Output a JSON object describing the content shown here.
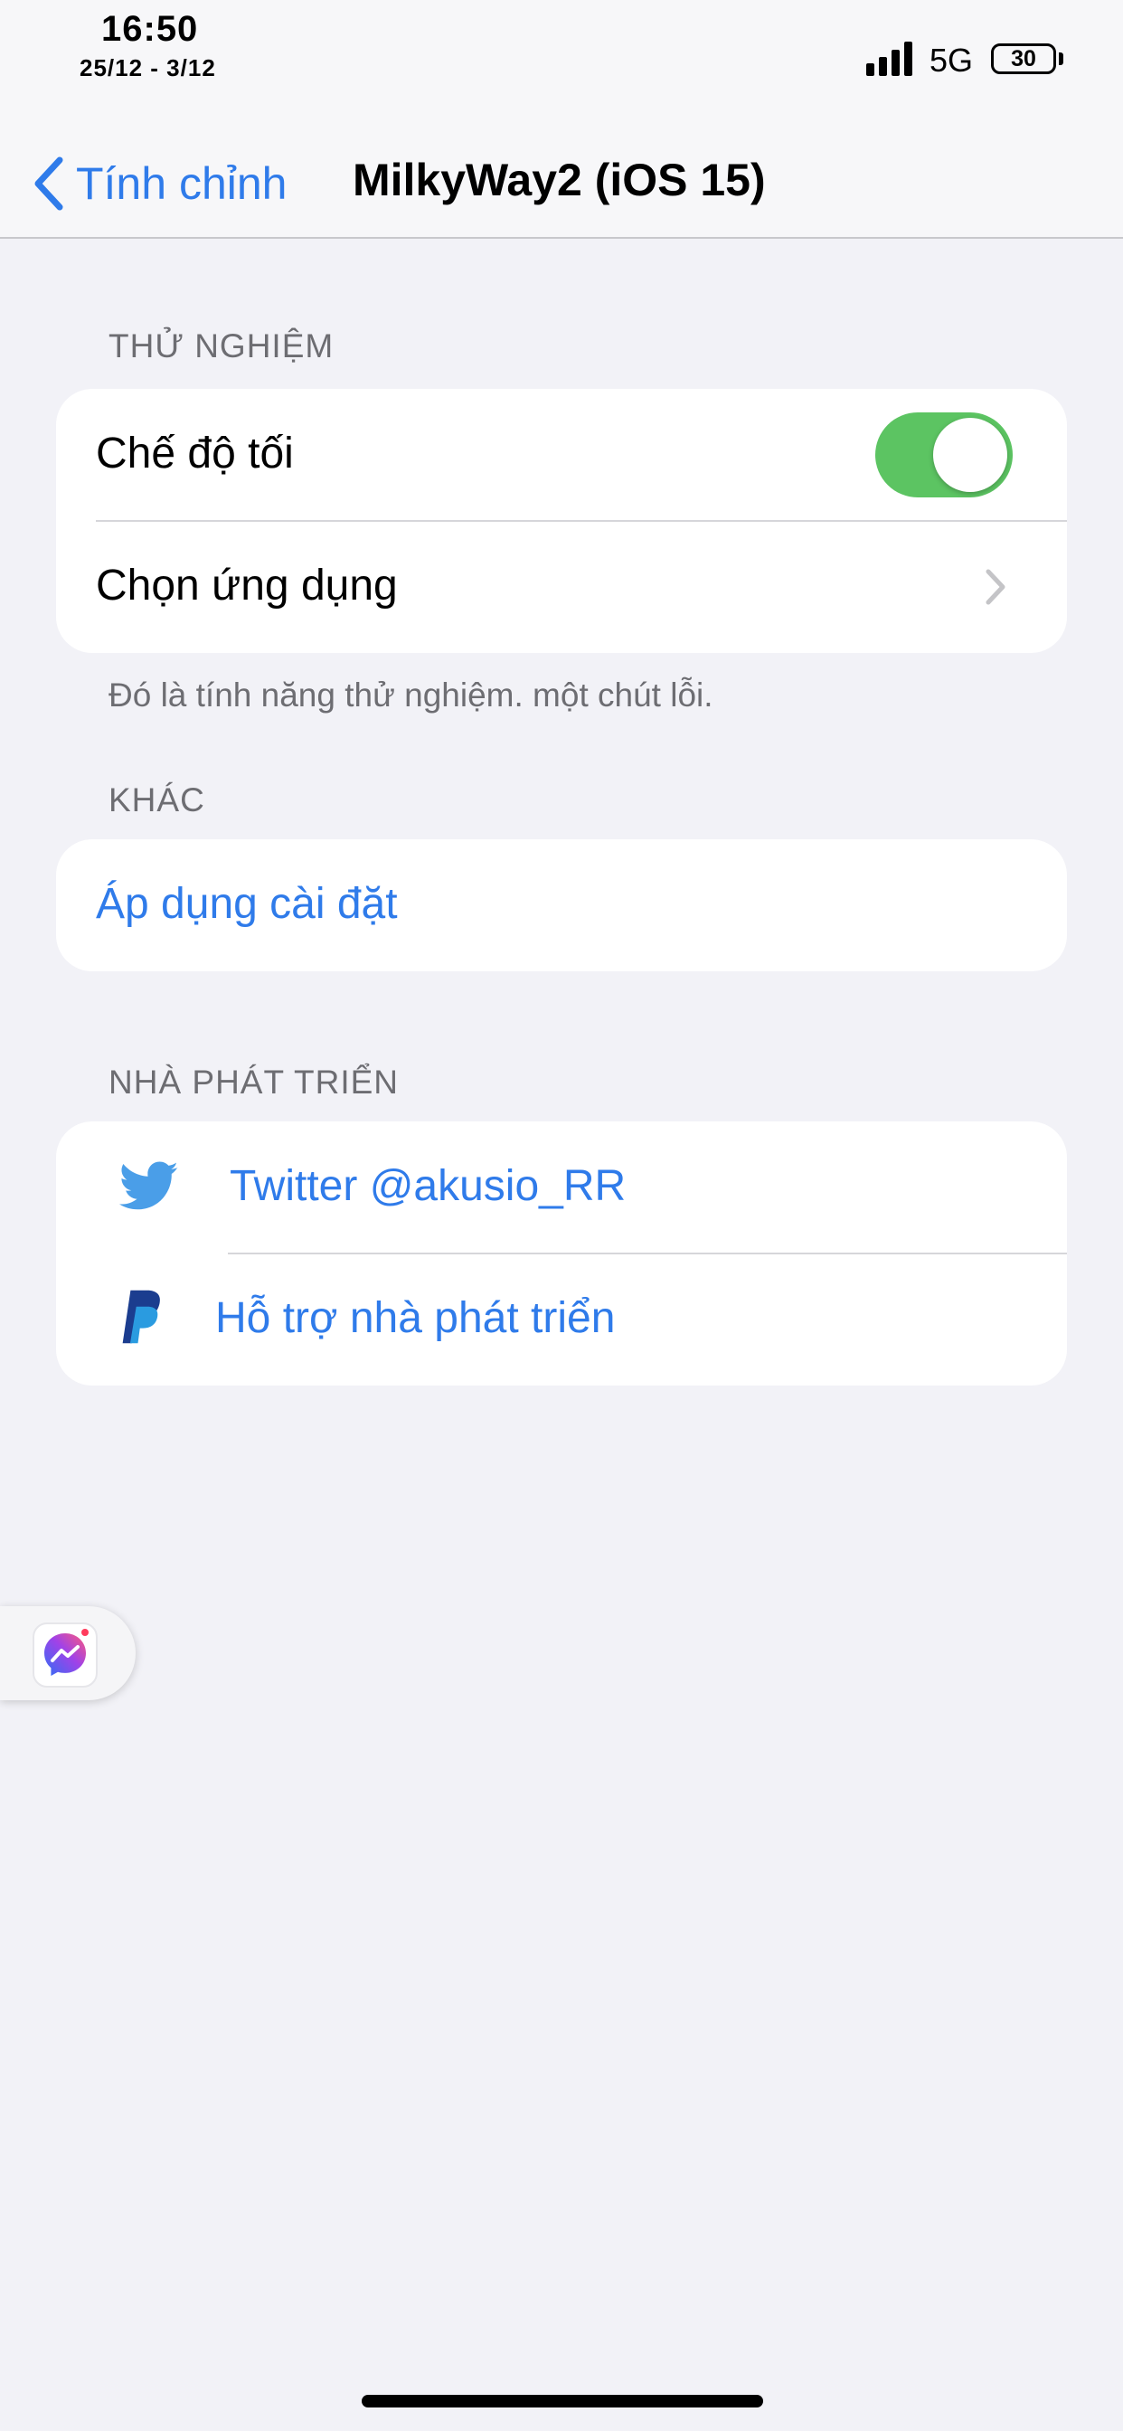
{
  "status_bar": {
    "time": "16:50",
    "date": "25/12 - 3/12",
    "network": "5G",
    "battery": "30"
  },
  "nav": {
    "back_label": "Tính chỉnh",
    "title": "MilkyWay2 (iOS 15)"
  },
  "sections": {
    "experimental": {
      "header": "THỬ NGHIỆM",
      "dark_mode_label": "Chế độ tối",
      "dark_mode_on": true,
      "choose_app_label": "Chọn ứng dụng",
      "footer": "Đó là tính năng thử nghiệm. một chút lỗi."
    },
    "other": {
      "header": "KHÁC",
      "apply_label": "Áp dụng cài đặt"
    },
    "developer": {
      "header": "NHÀ PHÁT TRIỂN",
      "twitter_label": "Twitter @akusio_RR",
      "support_label": "Hỗ trợ nhà phát triển"
    }
  },
  "icons": {
    "back": "chevron-left-icon",
    "disclosure": "chevron-right-icon",
    "twitter": "twitter-icon",
    "paypal": "paypal-icon",
    "floating": "messenger-icon"
  },
  "colors": {
    "accent": "#2f7bea",
    "toggle_on": "#5cc462",
    "background": "#f2f2f7"
  }
}
